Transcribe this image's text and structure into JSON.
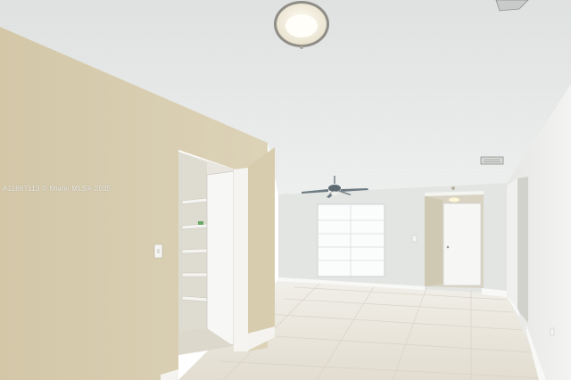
{
  "photo": {
    "watermark": "A11687113 © Miami MLS® 2025"
  },
  "colors": {
    "wall_left": "#d8cdb0",
    "wall_back": "#e4e6e3",
    "wall_right": "#ebecea",
    "ceiling": "#e9ebea",
    "floor": "#e7e3d9",
    "baseboard": "#f7f7f5"
  }
}
